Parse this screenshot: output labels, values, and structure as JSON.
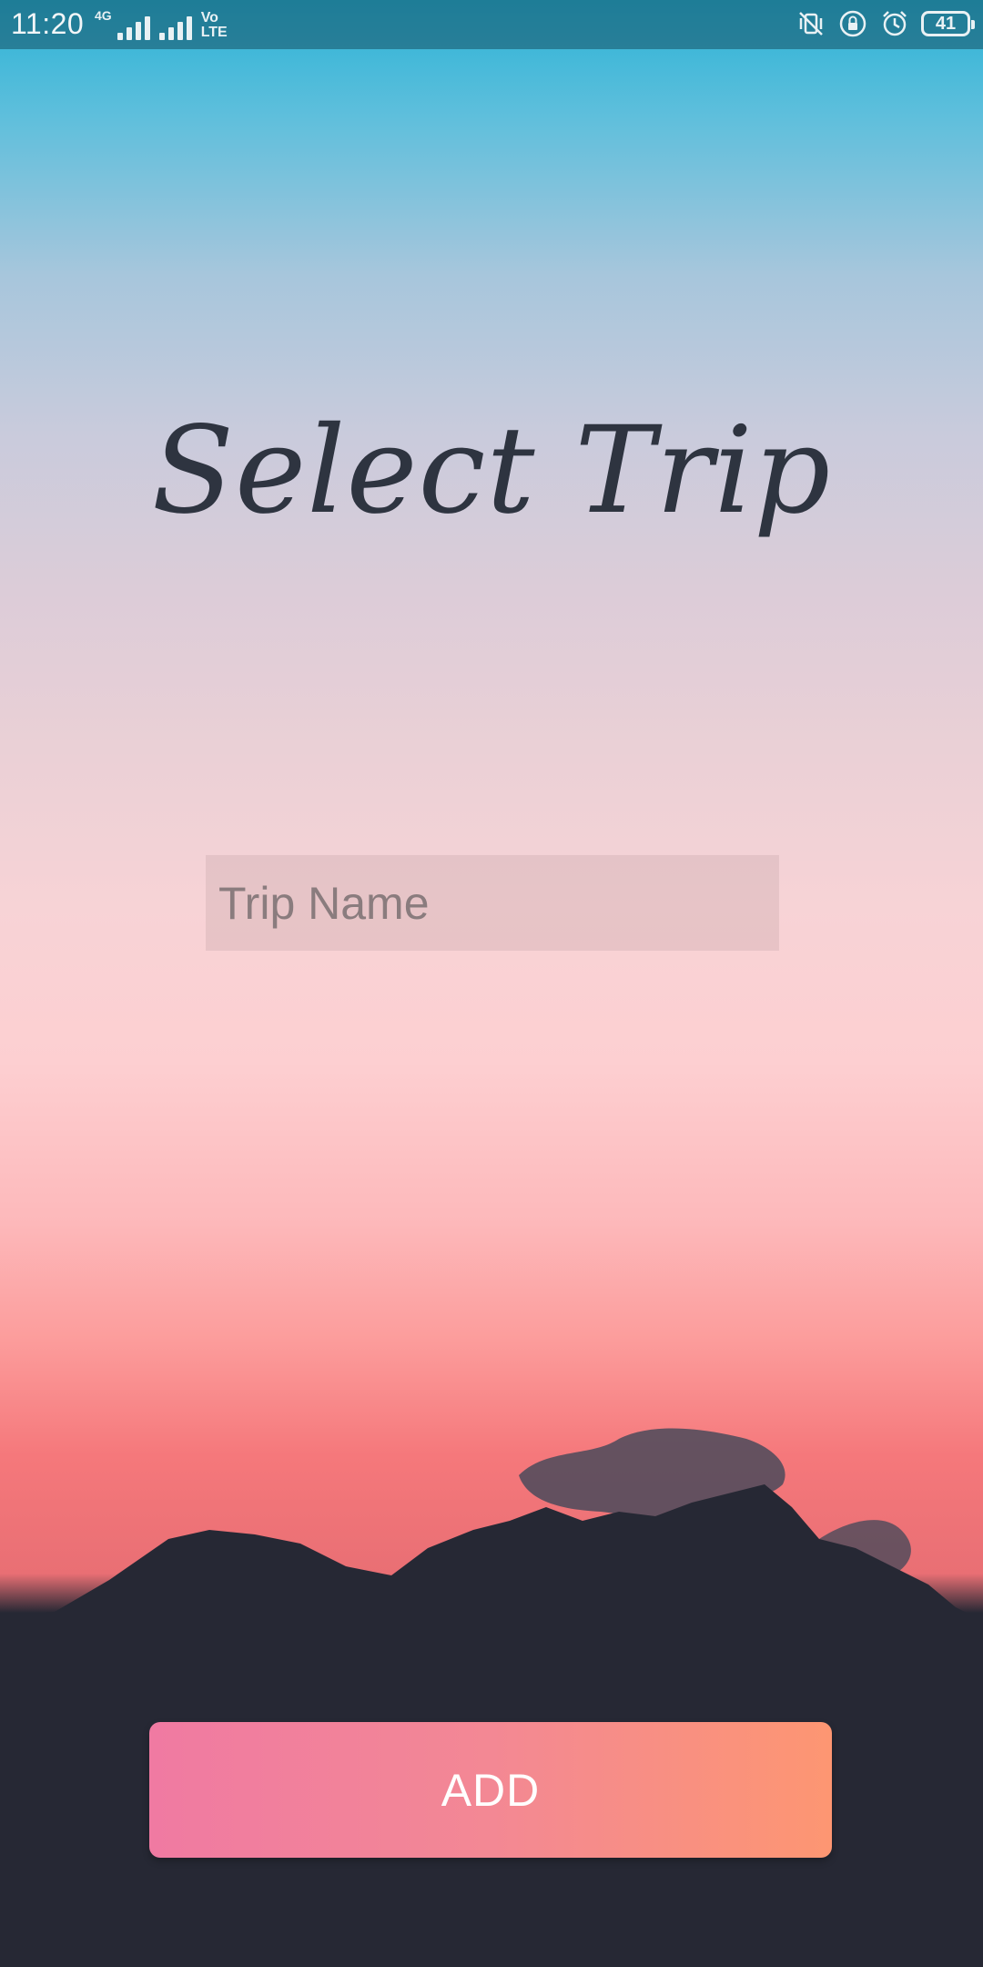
{
  "status_bar": {
    "time": "11:20",
    "network_label": "4G",
    "volte_label": "Vo\nLTE",
    "battery_level": "41",
    "icons": [
      "signal-icon",
      "signal-icon",
      "volte-icon",
      "vibrate-icon",
      "lock-rotation-icon",
      "alarm-icon",
      "battery-icon"
    ]
  },
  "page": {
    "title": "Select Trip"
  },
  "form": {
    "trip_name_placeholder": "Trip Name",
    "trip_name_value": ""
  },
  "actions": {
    "add_label": "ADD"
  },
  "colors": {
    "title": "#2e3440",
    "button_gradient_start": "#f07aa2",
    "button_gradient_end": "#fd9672",
    "button_text": "#ffffff",
    "mountain": "#262834"
  }
}
